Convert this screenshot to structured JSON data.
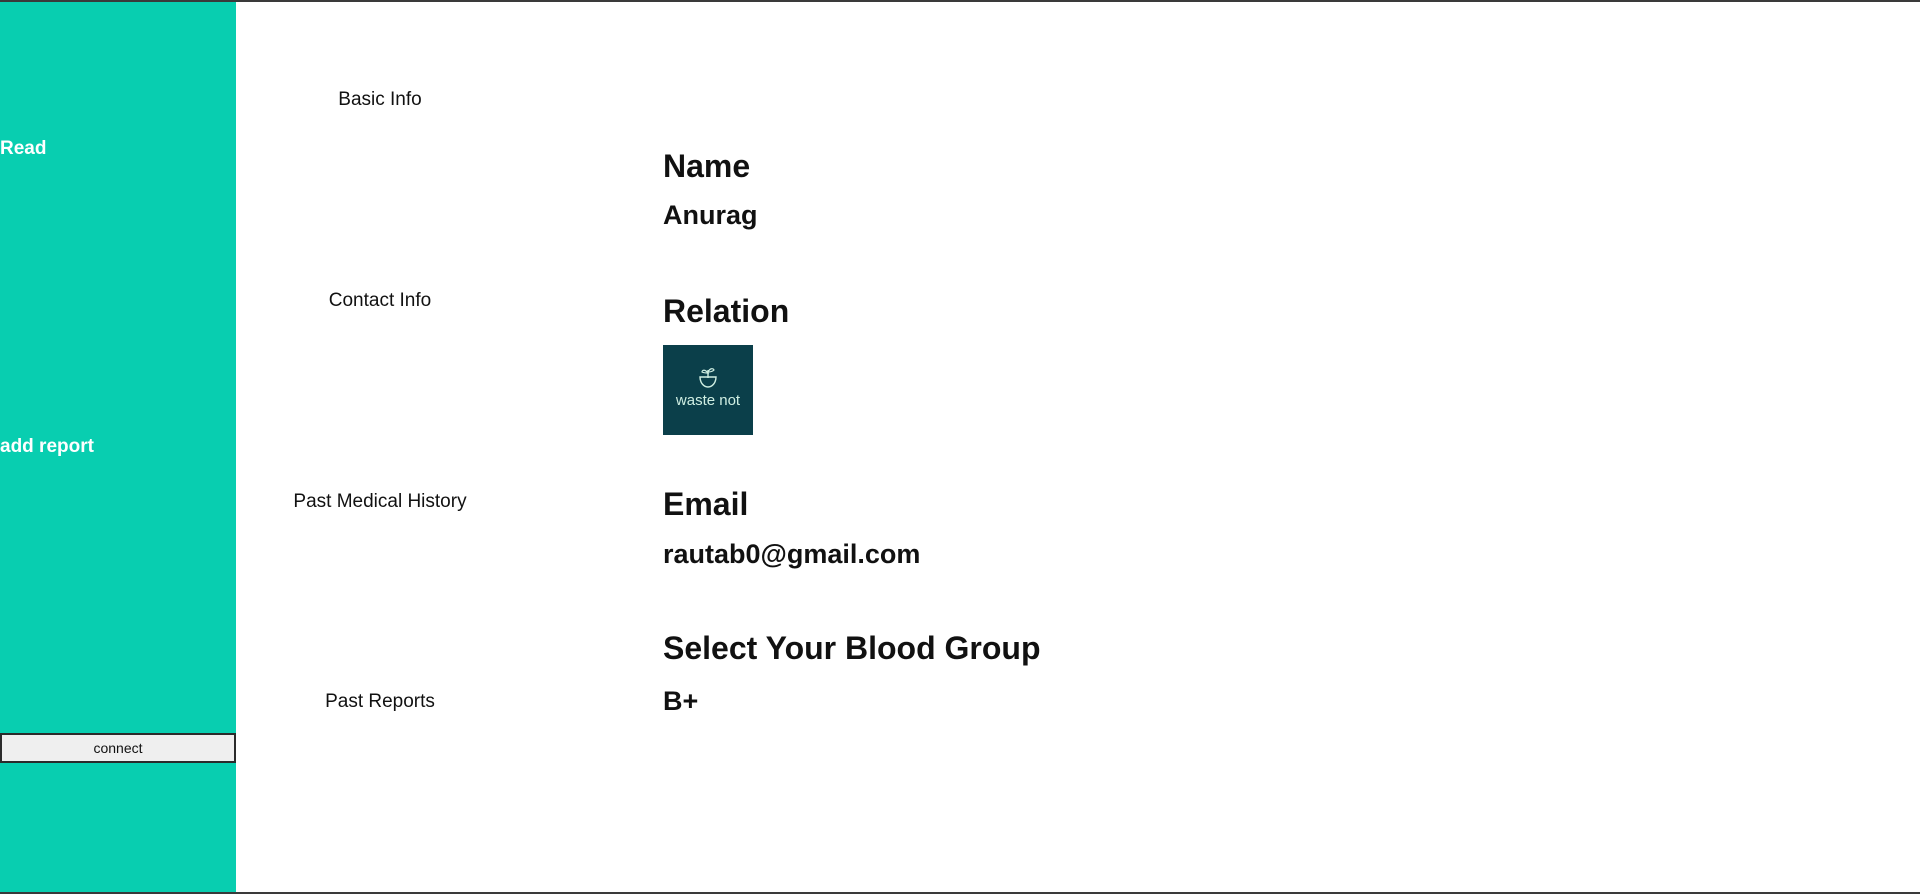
{
  "sidebar": {
    "read_label": "Read",
    "add_report_label": "add report",
    "connect_label": "connect"
  },
  "sections": {
    "basic_info": "Basic Info",
    "contact_info": "Contact Info",
    "past_medical_history": "Past Medical History",
    "past_reports": "Past Reports"
  },
  "profile": {
    "name_label": "Name",
    "name_value": "Anurag",
    "relation_label": "Relation",
    "relation_logo_text": "waste not",
    "email_label": "Email",
    "email_value": "rautab0@gmail.com",
    "blood_group_label": "Select Your Blood Group",
    "blood_group_value": "B+"
  },
  "colors": {
    "sidebar_bg": "#08ceb0",
    "logo_bg": "#0b3f4a"
  }
}
